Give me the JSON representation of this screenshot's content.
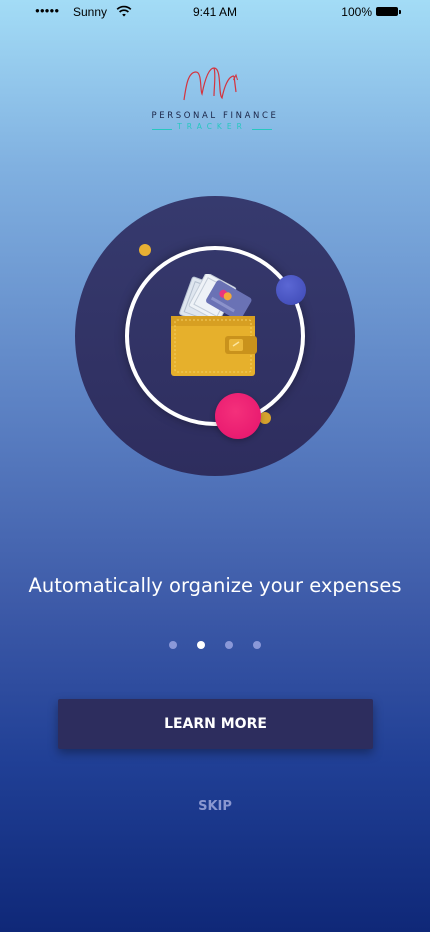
{
  "status_bar": {
    "signal_glyph": "●●●●●",
    "carrier": "Sunny",
    "wifi_icon": "wifi-icon",
    "time": "9:41 AM",
    "battery_percent": "100%",
    "battery_icon": "battery-icon"
  },
  "logo": {
    "line1": "PERSONAL FINANCE",
    "line2": "TRACKER",
    "mark_color": "#d4343f",
    "accent_color": "#27c7c0"
  },
  "illustration": {
    "icon": "wallet-with-cards-icon"
  },
  "onboarding": {
    "headline": "Automatically organize your expenses",
    "page_count": 4,
    "active_page": 2
  },
  "actions": {
    "learn_more_label": "LEARN MORE",
    "skip_label": "SKIP"
  },
  "colors": {
    "button_bg": "#2d2d5e",
    "circle_bg": "#333566",
    "pink_accent": "#e5136c",
    "blue_accent": "#4a55c4",
    "gold_accent": "#e8b033"
  }
}
